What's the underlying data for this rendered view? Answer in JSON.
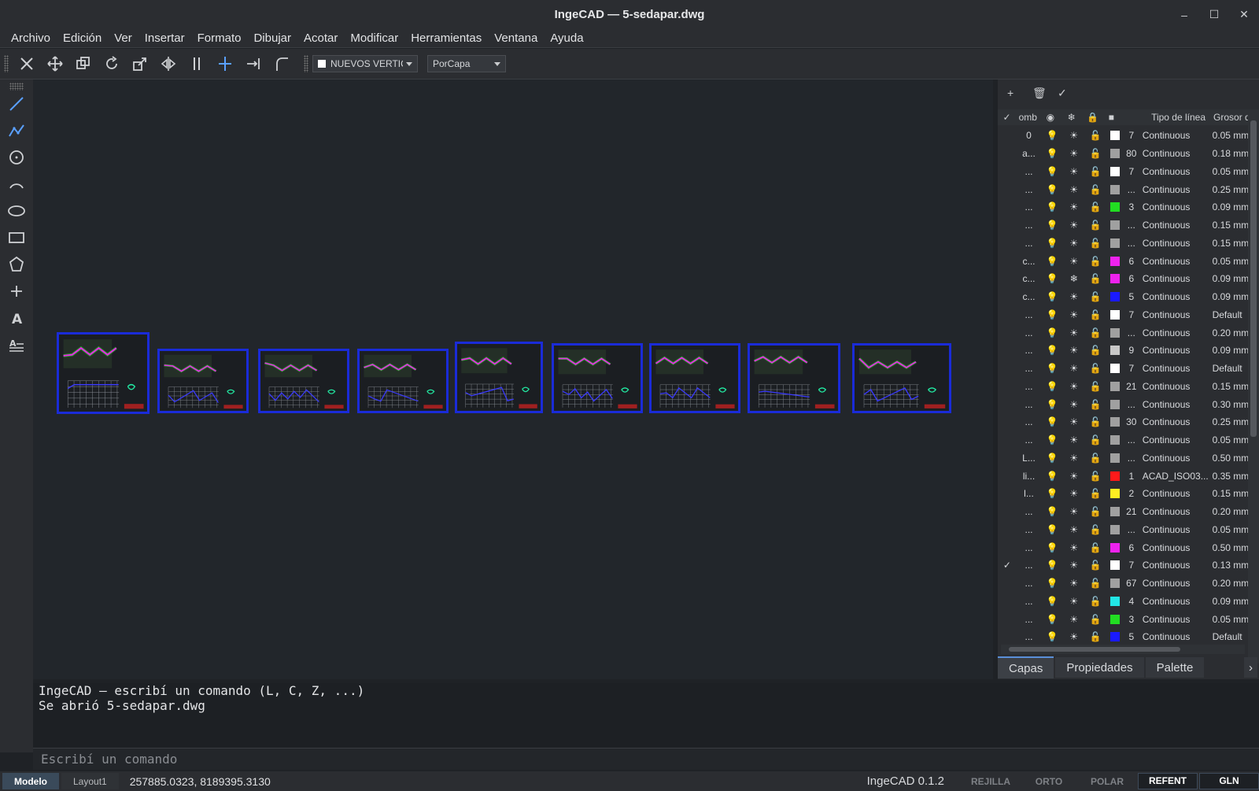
{
  "window": {
    "title": "IngeCAD — 5-sedapar.dwg",
    "min": "–",
    "max": "☐",
    "close": "✕"
  },
  "menu": [
    "Archivo",
    "Edición",
    "Ver",
    "Insertar",
    "Formato",
    "Dibujar",
    "Acotar",
    "Modificar",
    "Herramientas",
    "Ventana",
    "Ayuda"
  ],
  "toolbar": {
    "icons": [
      "delete-icon",
      "move-icon",
      "copy-icon",
      "rotate-icon",
      "scale-icon",
      "mirror-icon",
      "offset-icon",
      "trim-icon",
      "extend-icon",
      "fillet-icon"
    ],
    "layer_combo": "NUEVOS VERTICE",
    "linetype_combo": "PorCapa"
  },
  "left_tools": [
    "line-icon",
    "polyline-icon",
    "circle-icon",
    "arc-icon",
    "ellipse-icon",
    "rectangle-icon",
    "polygon-icon",
    "point-icon",
    "text-icon",
    "mtext-icon"
  ],
  "layers_panel": {
    "tools": [
      "+",
      "🗑",
      "✓"
    ],
    "headers": {
      "check": "✓",
      "name": "omb",
      "on": "◉",
      "freeze": "❄",
      "lock": "🔒",
      "color": "■",
      "linetype": "Tipo de línea",
      "lineweight": "Grosor d"
    },
    "rows": [
      {
        "chk": "",
        "name": "0",
        "frz": "☀",
        "color": "#ffffff",
        "num": "7",
        "lt": "Continuous",
        "lw": "0.05 mm"
      },
      {
        "chk": "",
        "name": "a...",
        "frz": "☀",
        "color": "#a0a0a0",
        "num": "80",
        "lt": "Continuous",
        "lw": "0.18 mm"
      },
      {
        "chk": "",
        "name": "...",
        "frz": "☀",
        "color": "#ffffff",
        "num": "7",
        "lt": "Continuous",
        "lw": "0.05 mm"
      },
      {
        "chk": "",
        "name": "...",
        "frz": "☀",
        "color": "#a0a0a0",
        "num": "...",
        "lt": "Continuous",
        "lw": "0.25 mm"
      },
      {
        "chk": "",
        "name": "...",
        "frz": "☀",
        "color": "#22dd22",
        "num": "3",
        "lt": "Continuous",
        "lw": "0.09 mm"
      },
      {
        "chk": "",
        "name": "...",
        "frz": "☀",
        "color": "#a0a0a0",
        "num": "...",
        "lt": "Continuous",
        "lw": "0.15 mm"
      },
      {
        "chk": "",
        "name": "...",
        "frz": "☀",
        "color": "#a0a0a0",
        "num": "...",
        "lt": "Continuous",
        "lw": "0.15 mm"
      },
      {
        "chk": "",
        "name": "c...",
        "frz": "☀",
        "color": "#ee22ee",
        "num": "6",
        "lt": "Continuous",
        "lw": "0.05 mm"
      },
      {
        "chk": "",
        "name": "c...",
        "frz": "❄",
        "color": "#ee22ee",
        "num": "6",
        "lt": "Continuous",
        "lw": "0.09 mm"
      },
      {
        "chk": "",
        "name": "c...",
        "frz": "☀",
        "color": "#1a1aff",
        "num": "5",
        "lt": "Continuous",
        "lw": "0.09 mm"
      },
      {
        "chk": "",
        "name": "...",
        "frz": "☀",
        "color": "#ffffff",
        "num": "7",
        "lt": "Continuous",
        "lw": "Default"
      },
      {
        "chk": "",
        "name": "...",
        "frz": "☀",
        "color": "#a0a0a0",
        "num": "...",
        "lt": "Continuous",
        "lw": "0.20 mm"
      },
      {
        "chk": "",
        "name": "...",
        "frz": "☀",
        "color": "#c8c8c8",
        "num": "9",
        "lt": "Continuous",
        "lw": "0.09 mm"
      },
      {
        "chk": "",
        "name": "...",
        "frz": "☀",
        "color": "#ffffff",
        "num": "7",
        "lt": "Continuous",
        "lw": "Default"
      },
      {
        "chk": "",
        "name": "...",
        "frz": "☀",
        "color": "#a0a0a0",
        "num": "21",
        "lt": "Continuous",
        "lw": "0.15 mm"
      },
      {
        "chk": "",
        "name": "...",
        "frz": "☀",
        "color": "#a0a0a0",
        "num": "...",
        "lt": "Continuous",
        "lw": "0.30 mm"
      },
      {
        "chk": "",
        "name": "...",
        "frz": "☀",
        "color": "#a0a0a0",
        "num": "30",
        "lt": "Continuous",
        "lw": "0.25 mm"
      },
      {
        "chk": "",
        "name": "...",
        "frz": "☀",
        "color": "#a0a0a0",
        "num": "...",
        "lt": "Continuous",
        "lw": "0.05 mm"
      },
      {
        "chk": "",
        "name": "L...",
        "frz": "☀",
        "color": "#a0a0a0",
        "num": "...",
        "lt": "Continuous",
        "lw": "0.50 mm"
      },
      {
        "chk": "",
        "name": "li...",
        "frz": "☀",
        "color": "#ff1a1a",
        "num": "1",
        "lt": "ACAD_ISO03...",
        "lw": "0.35 mm"
      },
      {
        "chk": "",
        "name": "l...",
        "frz": "☀",
        "color": "#ffee22",
        "num": "2",
        "lt": "Continuous",
        "lw": "0.15 mm"
      },
      {
        "chk": "",
        "name": "...",
        "frz": "☀",
        "color": "#a0a0a0",
        "num": "21",
        "lt": "Continuous",
        "lw": "0.20 mm"
      },
      {
        "chk": "",
        "name": "...",
        "frz": "☀",
        "color": "#a0a0a0",
        "num": "...",
        "lt": "Continuous",
        "lw": "0.05 mm"
      },
      {
        "chk": "",
        "name": "...",
        "frz": "☀",
        "color": "#ee22ee",
        "num": "6",
        "lt": "Continuous",
        "lw": "0.50 mm"
      },
      {
        "chk": "✓",
        "name": "...",
        "frz": "☀",
        "color": "#ffffff",
        "num": "7",
        "lt": "Continuous",
        "lw": "0.13 mm"
      },
      {
        "chk": "",
        "name": "...",
        "frz": "☀",
        "color": "#a0a0a0",
        "num": "67",
        "lt": "Continuous",
        "lw": "0.20 mm"
      },
      {
        "chk": "",
        "name": "...",
        "frz": "☀",
        "color": "#22e6e6",
        "num": "4",
        "lt": "Continuous",
        "lw": "0.09 mm"
      },
      {
        "chk": "",
        "name": "...",
        "frz": "☀",
        "color": "#22dd22",
        "num": "3",
        "lt": "Continuous",
        "lw": "0.05 mm"
      },
      {
        "chk": "",
        "name": "...",
        "frz": "☀",
        "color": "#1a1aff",
        "num": "5",
        "lt": "Continuous",
        "lw": "Default"
      }
    ],
    "tabs": [
      "Capas",
      "Propiedades",
      "Palette"
    ],
    "tab_more": "›"
  },
  "command": {
    "lines": [
      "IngeCAD — escribí un comando (L, C, Z, ...)",
      "Se abrió 5-sedapar.dwg"
    ],
    "placeholder": "Escribí un comando"
  },
  "status": {
    "tabs": [
      "Modelo",
      "Layout1"
    ],
    "coords": "257885.0323, 8189395.3130",
    "version": "IngeCAD 0.1.2",
    "modes": [
      {
        "label": "REJILLA",
        "on": false
      },
      {
        "label": "ORTO",
        "on": false
      },
      {
        "label": "POLAR",
        "on": false
      },
      {
        "label": "REFENT",
        "on": true
      },
      {
        "label": "GLN",
        "on": true
      }
    ]
  },
  "colors": {
    "accent": "#1a2bd8",
    "magenta": "#ee22ee",
    "green": "#22dd22"
  }
}
